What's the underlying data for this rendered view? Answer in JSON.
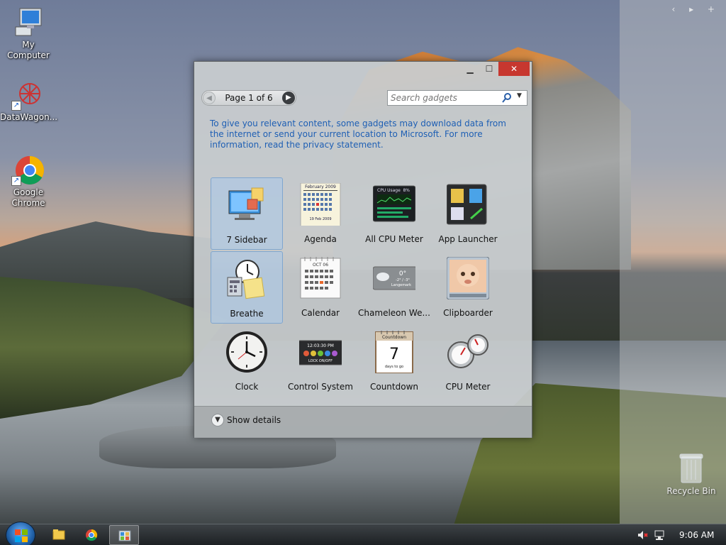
{
  "desktop": {
    "icons": [
      {
        "label": "My Computer"
      },
      {
        "label": "DataWagon..."
      },
      {
        "label_line1": "Google",
        "label_line2": "Chrome"
      }
    ],
    "sidebar_nav": "‹ ▸ +",
    "recycle_bin": "Recycle Bin"
  },
  "gallery": {
    "pager": {
      "label": "Page 1 of 6"
    },
    "search": {
      "placeholder": "Search gadgets"
    },
    "notice": "To give you relevant content, some gadgets may download data from the internet or send your current location to Microsoft. For more information, read the privacy statement.",
    "gadgets": [
      {
        "name": "7 Sidebar"
      },
      {
        "name": "Agenda",
        "sub_month": "February 2009",
        "sub_footer": "19 Feb 2009"
      },
      {
        "name": "All CPU Meter",
        "sub_title": "CPU Usage",
        "sub_value": "8%"
      },
      {
        "name": "App Launcher"
      },
      {
        "name": "Breathe"
      },
      {
        "name": "Calendar",
        "sub_month": "OCT 06"
      },
      {
        "name": "Chameleon We...",
        "sub_temp": "0°",
        "sub_range": "-2° / -3°",
        "sub_city": "Langemark"
      },
      {
        "name": "Clipboarder"
      },
      {
        "name": "Clock"
      },
      {
        "name": "Control System",
        "sub_time": "12:03:30 PM",
        "sub_lock": "LOCK ON/OFF"
      },
      {
        "name": "Countdown",
        "sub_title": "Countdown",
        "sub_num": "7",
        "sub_days": "days to go"
      },
      {
        "name": "CPU Meter"
      }
    ],
    "show_details": "Show details"
  },
  "taskbar": {
    "clock": "9:06 AM"
  },
  "colors": {
    "accent_link": "#1e5fb4",
    "close_button": "#c7372f",
    "selection": "#aac8e8"
  }
}
